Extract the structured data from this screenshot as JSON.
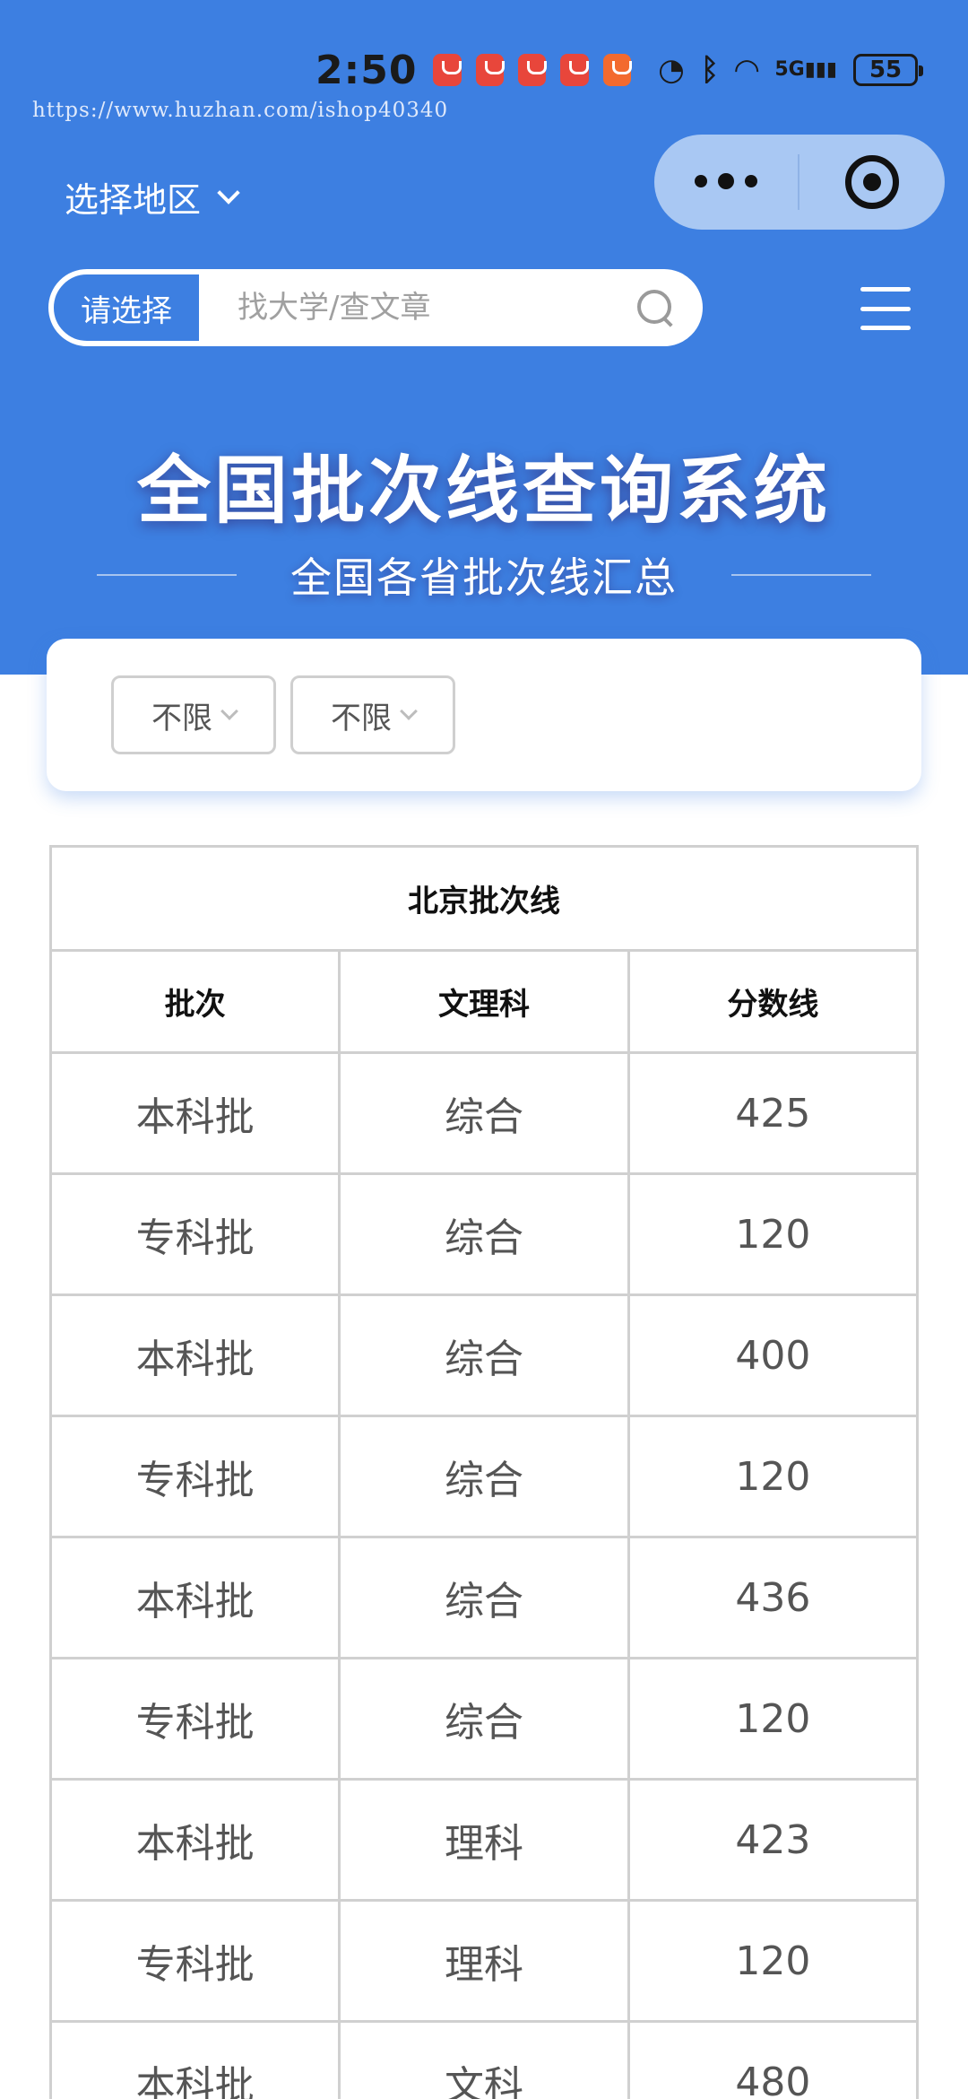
{
  "status_bar": {
    "time": "2:50",
    "network": "5G",
    "battery": "55"
  },
  "watermark": "https://www.huzhan.com/ishop40340",
  "header": {
    "region_label": "选择地区",
    "search_category": "请选择",
    "search_placeholder": "找大学/查文章"
  },
  "banner": {
    "title": "全国批次线查询系统",
    "subtitle": "全国各省批次线汇总"
  },
  "filters": [
    {
      "selected": "不限"
    },
    {
      "selected": "不限"
    }
  ],
  "table": {
    "caption": "北京批次线",
    "headers": [
      "批次",
      "文理科",
      "分数线"
    ],
    "rows": [
      [
        "本科批",
        "综合",
        "425"
      ],
      [
        "专科批",
        "综合",
        "120"
      ],
      [
        "本科批",
        "综合",
        "400"
      ],
      [
        "专科批",
        "综合",
        "120"
      ],
      [
        "本科批",
        "综合",
        "436"
      ],
      [
        "专科批",
        "综合",
        "120"
      ],
      [
        "本科批",
        "理科",
        "423"
      ],
      [
        "专科批",
        "理科",
        "120"
      ],
      [
        "本科批",
        "文科",
        "480"
      ]
    ]
  },
  "colors": {
    "primary": "#3d7fe1",
    "capsule": "#a9c8f3",
    "border": "#d0d0d0"
  }
}
